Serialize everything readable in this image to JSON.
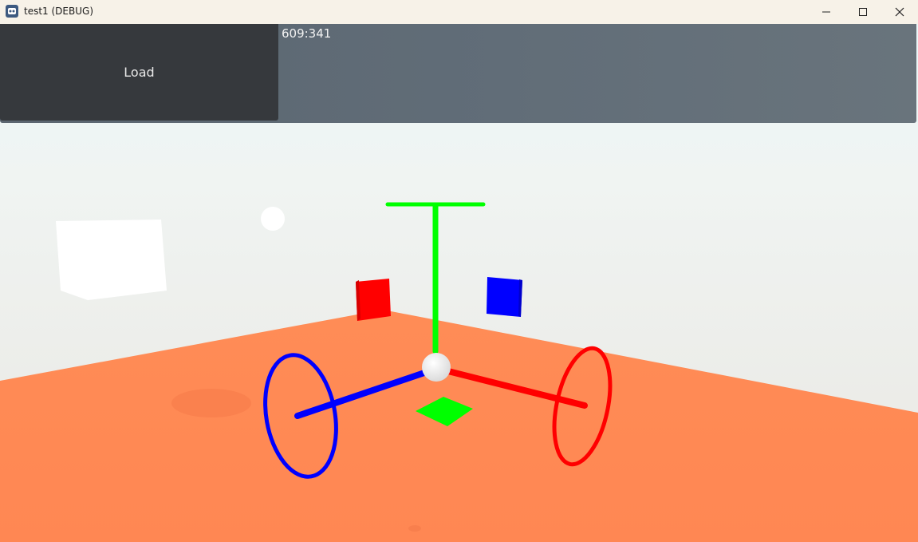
{
  "window": {
    "title": "test1 (DEBUG)",
    "app_icon": "godot-engine-icon",
    "controls": [
      "minimize-icon",
      "maximize-icon",
      "close-icon"
    ]
  },
  "ui": {
    "load_button_label": "Load",
    "mouse_position": "609:341"
  },
  "scene": {
    "floor_color": "#ff8a55",
    "sky_color": "#eef9fb",
    "x_axis_color": "#ff0000",
    "y_axis_color": "#00ff00",
    "z_axis_color": "#0000ff",
    "objects": [
      "white-cube",
      "white-sphere",
      "red-cube",
      "blue-cube",
      "transform-gizmo",
      "green-plane-handle"
    ]
  }
}
